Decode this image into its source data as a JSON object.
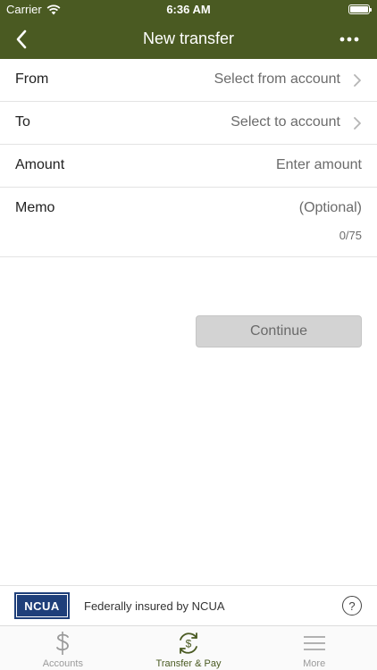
{
  "status_bar": {
    "carrier": "Carrier",
    "time": "6:36 AM"
  },
  "header": {
    "title": "New transfer"
  },
  "form": {
    "from": {
      "label": "From",
      "value": "Select from account"
    },
    "to": {
      "label": "To",
      "value": "Select to account"
    },
    "amount": {
      "label": "Amount",
      "placeholder": "Enter amount"
    },
    "memo": {
      "label": "Memo",
      "placeholder": "(Optional)",
      "counter": "0/75"
    }
  },
  "actions": {
    "continue_label": "Continue"
  },
  "footer": {
    "ncua_logo_text": "NCUA",
    "insured_text": "Federally insured by NCUA",
    "help_label": "?"
  },
  "tabs": [
    {
      "label": "Accounts",
      "icon": "dollar-icon"
    },
    {
      "label": "Transfer & Pay",
      "icon": "transfer-pay-icon"
    },
    {
      "label": "More",
      "icon": "menu-icon"
    }
  ],
  "colors": {
    "brand": "#4a5a22",
    "button_disabled": "#d3d3d3"
  }
}
